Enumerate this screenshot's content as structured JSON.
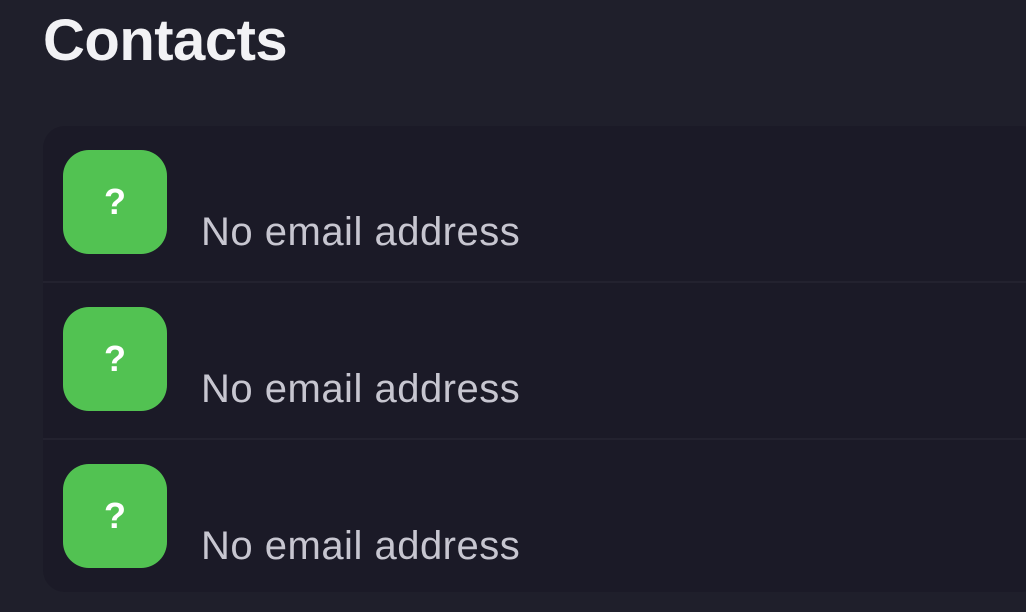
{
  "header": {
    "title": "Contacts"
  },
  "contacts": [
    {
      "avatar_icon": "unknown-contact-icon",
      "avatar_glyph": "?",
      "avatar_color": "#52c252",
      "email": "No email address"
    },
    {
      "avatar_icon": "unknown-contact-icon",
      "avatar_glyph": "?",
      "avatar_color": "#52c252",
      "email": "No email address"
    },
    {
      "avatar_icon": "unknown-contact-icon",
      "avatar_glyph": "?",
      "avatar_color": "#52c252",
      "email": "No email address"
    }
  ]
}
